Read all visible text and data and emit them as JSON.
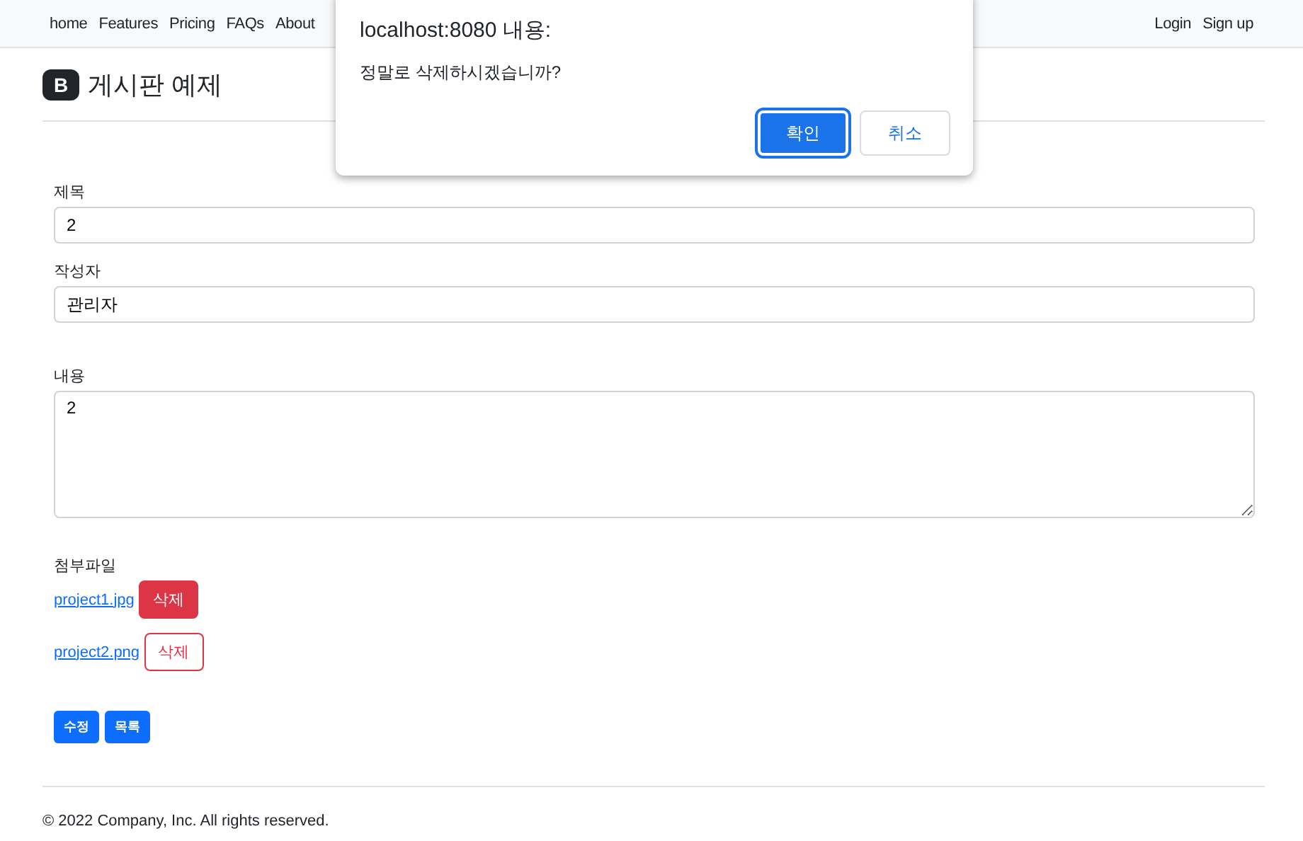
{
  "nav": {
    "links": [
      "home",
      "Features",
      "Pricing",
      "FAQs",
      "About"
    ],
    "auth": [
      "Login",
      "Sign up"
    ]
  },
  "header": {
    "logo": "B",
    "title": "게시판 예제"
  },
  "form": {
    "fields": [
      {
        "label": "제목",
        "value": "2",
        "kind": "input"
      },
      {
        "label": "작성자",
        "value": "관리자",
        "kind": "input"
      },
      {
        "label": "내용",
        "value": "2",
        "kind": "textarea"
      }
    ],
    "attachments_label": "첨부파일",
    "attachments": [
      {
        "name": "project1.jpg",
        "button": "삭제",
        "kind": "filled"
      },
      {
        "name": "project2.png",
        "button": "삭제",
        "kind": "outline"
      }
    ],
    "actions": [
      "수정",
      "목록"
    ]
  },
  "footer": "© 2022 Company, Inc. All rights reserved.",
  "dialog": {
    "title": "localhost:8080 내용:",
    "message": "정말로 삭제하시겠습니까?",
    "ok": "확인",
    "cancel": "취소"
  }
}
